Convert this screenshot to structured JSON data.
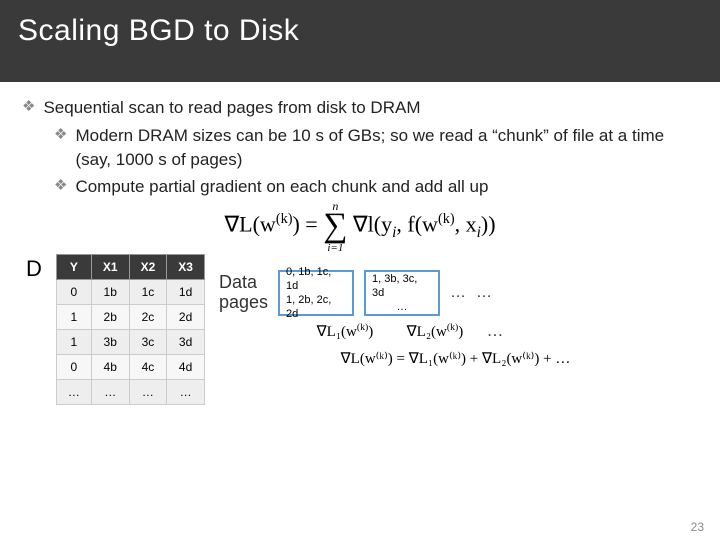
{
  "title": "Scaling BGD to Disk",
  "bullets": {
    "b1": "Sequential scan to read pages from disk to DRAM",
    "b1a": "Modern DRAM sizes can be 10 s of GBs; so we read a “chunk” of file at a time (say, 1000 s of pages)",
    "b1b": "Compute partial gradient on each chunk and add all up"
  },
  "main_formula": {
    "lhs": "∇L(w",
    "k": "(k)",
    "eq": ") = ",
    "n": "n",
    "i1": "i=1",
    "rhs_a": "∇l(y",
    "rhs_b": ", f(w",
    "rhs_c": ", x",
    "rhs_d": "))",
    "i": "i"
  },
  "D": "D",
  "table": {
    "headers": [
      "Y",
      "X1",
      "X2",
      "X3"
    ],
    "rows": [
      [
        "0",
        "1b",
        "1c",
        "1d"
      ],
      [
        "1",
        "2b",
        "2c",
        "2d"
      ],
      [
        "1",
        "3b",
        "3c",
        "3d"
      ],
      [
        "0",
        "4b",
        "4c",
        "4d"
      ],
      [
        "…",
        "…",
        "…",
        "…"
      ]
    ]
  },
  "pages_label_1": "Data",
  "pages_label_2": "pages",
  "page1_l1": "0, 1b, 1c, 1d",
  "page1_l2": "1, 2b, 2c, 2d",
  "page2_l1": "1, 3b, 3c, 3d",
  "page2_l2": "…",
  "ellipsis": "…",
  "grad1": "∇L₁(w",
  "grad2": "∇L₂(w",
  "grad_k": "(k)",
  "grad_close": ")",
  "sum_eq": "∇L(w⁽ᵏ⁾) = ∇L₁(w⁽ᵏ⁾) + ∇L₂(w⁽ᵏ⁾) + …",
  "page_number": "23",
  "chart_data": {
    "type": "table",
    "columns": [
      "Y",
      "X1",
      "X2",
      "X3"
    ],
    "rows": [
      [
        "0",
        "1b",
        "1c",
        "1d"
      ],
      [
        "1",
        "2b",
        "2c",
        "2d"
      ],
      [
        "1",
        "3b",
        "3c",
        "3d"
      ],
      [
        "0",
        "4b",
        "4c",
        "4d"
      ]
    ]
  }
}
